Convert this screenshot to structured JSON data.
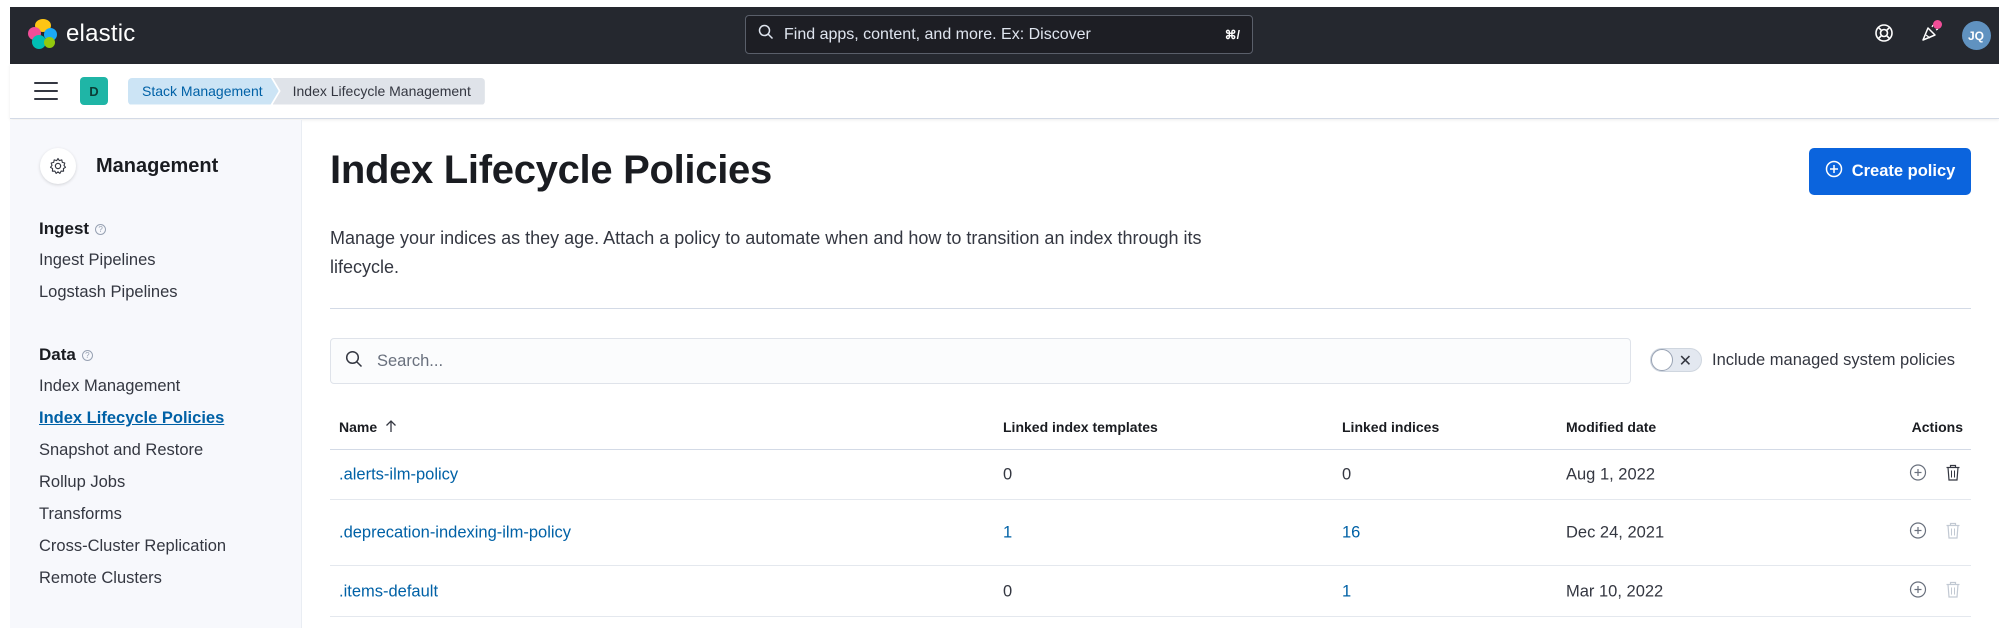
{
  "header": {
    "brand": "elastic",
    "search_placeholder": "Find apps, content, and more. Ex: Discover",
    "search_shortcut": "⌘/",
    "avatar_initials": "JQ"
  },
  "subbar": {
    "space_initial": "D",
    "breadcrumbs": [
      "Stack Management",
      "Index Lifecycle Management"
    ]
  },
  "sidebar": {
    "title": "Management",
    "groups": [
      {
        "label": "Ingest",
        "items": [
          "Ingest Pipelines",
          "Logstash Pipelines"
        ]
      },
      {
        "label": "Data",
        "items": [
          "Index Management",
          "Index Lifecycle Policies",
          "Snapshot and Restore",
          "Rollup Jobs",
          "Transforms",
          "Cross-Cluster Replication",
          "Remote Clusters"
        ]
      }
    ]
  },
  "main": {
    "title": "Index Lifecycle Policies",
    "create_button": "Create policy",
    "description_line1": "Manage your indices as they age. Attach a policy to automate when and how to transition an index through its",
    "description_line2": "lifecycle.",
    "search_placeholder": "Search...",
    "toggle_label": "Include managed system policies",
    "columns": [
      "Name",
      "Linked index templates",
      "Linked indices",
      "Modified date",
      "Actions"
    ],
    "rows": [
      {
        "name": ".alerts-ilm-policy",
        "templates": "0",
        "indices": "0",
        "modified": "Aug 1, 2022"
      },
      {
        "name": ".deprecation-indexing-ilm-policy",
        "templates": "1",
        "indices": "16",
        "modified": "Dec 24, 2021"
      },
      {
        "name": ".items-default",
        "templates": "0",
        "indices": "1",
        "modified": "Mar 10, 2022"
      }
    ]
  },
  "colors": {
    "topbar": "#25282f",
    "accent": "#0b64dd",
    "link": "#0061a6"
  }
}
